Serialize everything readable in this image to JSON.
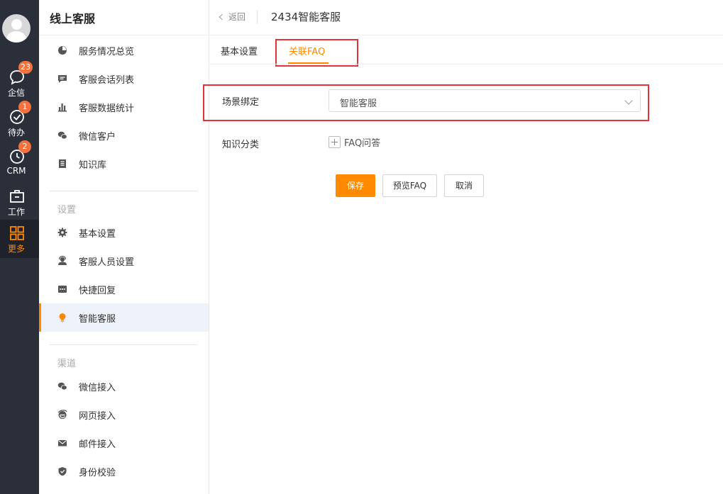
{
  "rail": {
    "items": [
      {
        "label": "企信",
        "badge": "23"
      },
      {
        "label": "待办",
        "badge": "1"
      },
      {
        "label": "CRM",
        "badge": "2"
      },
      {
        "label": "工作",
        "badge": ""
      },
      {
        "label": "更多",
        "badge": ""
      }
    ],
    "active_color": "#ff8a00"
  },
  "sidebar": {
    "title": "线上客服",
    "items": [
      {
        "label": "服务情况总览",
        "icon": "pie-chart-icon"
      },
      {
        "label": "客服会话列表",
        "icon": "chat-list-icon"
      },
      {
        "label": "客服数据统计",
        "icon": "bar-chart-icon"
      },
      {
        "label": "微信客户",
        "icon": "wechat-icon"
      },
      {
        "label": "知识库",
        "icon": "book-icon"
      }
    ],
    "settings_label": "设置",
    "settings_items": [
      {
        "label": "基本设置",
        "icon": "gear-icon"
      },
      {
        "label": "客服人员设置",
        "icon": "agent-icon"
      },
      {
        "label": "快捷回复",
        "icon": "quick-reply-icon"
      },
      {
        "label": "智能客服",
        "icon": "bulb-icon"
      }
    ],
    "channels_label": "渠道",
    "channel_items": [
      {
        "label": "微信接入",
        "icon": "wechat-icon"
      },
      {
        "label": "网页接入",
        "icon": "ie-icon"
      },
      {
        "label": "邮件接入",
        "icon": "mail-icon"
      },
      {
        "label": "身份校验",
        "icon": "shield-icon"
      }
    ]
  },
  "header": {
    "back_label": "返回",
    "title": "2434智能客服"
  },
  "tabs": [
    {
      "label": "基本设置"
    },
    {
      "label": "关联FAQ"
    }
  ],
  "form": {
    "scene_label": "场景绑定",
    "scene_value": "智能客服",
    "category_label": "知识分类",
    "category_add": "FAQ问答"
  },
  "actions": {
    "save": "保存",
    "preview": "预览FAQ",
    "cancel": "取消"
  },
  "colors": {
    "accent": "#ff8a00",
    "highlight_box": "#e0343a",
    "rail_bg": "#2b2f3a"
  }
}
